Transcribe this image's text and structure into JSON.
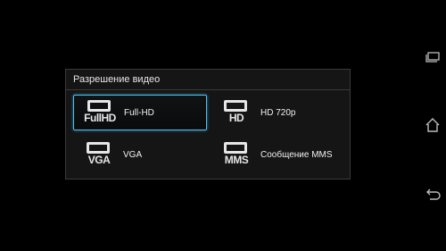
{
  "dialog": {
    "title": "Разрешение видео",
    "options": [
      {
        "icon_name": "fullhd-resolution-icon",
        "icon_text": "FullHD",
        "label": "Full-HD",
        "selected": true
      },
      {
        "icon_name": "hd-resolution-icon",
        "icon_text": "HD",
        "label": "HD 720p",
        "selected": false
      },
      {
        "icon_name": "vga-resolution-icon",
        "icon_text": "VGA",
        "label": "VGA",
        "selected": false
      },
      {
        "icon_name": "mms-resolution-icon",
        "icon_text": "MMS",
        "label": "Сообщение MMS",
        "selected": false
      }
    ]
  },
  "navigation": {
    "recent_apps_icon": "recent-apps-icon",
    "home_icon": "home-icon",
    "back_icon": "back-icon"
  },
  "colors": {
    "background": "#000000",
    "dialog": "#151515",
    "selection_accent": "#4cc3f0",
    "text": "#ffffff"
  }
}
